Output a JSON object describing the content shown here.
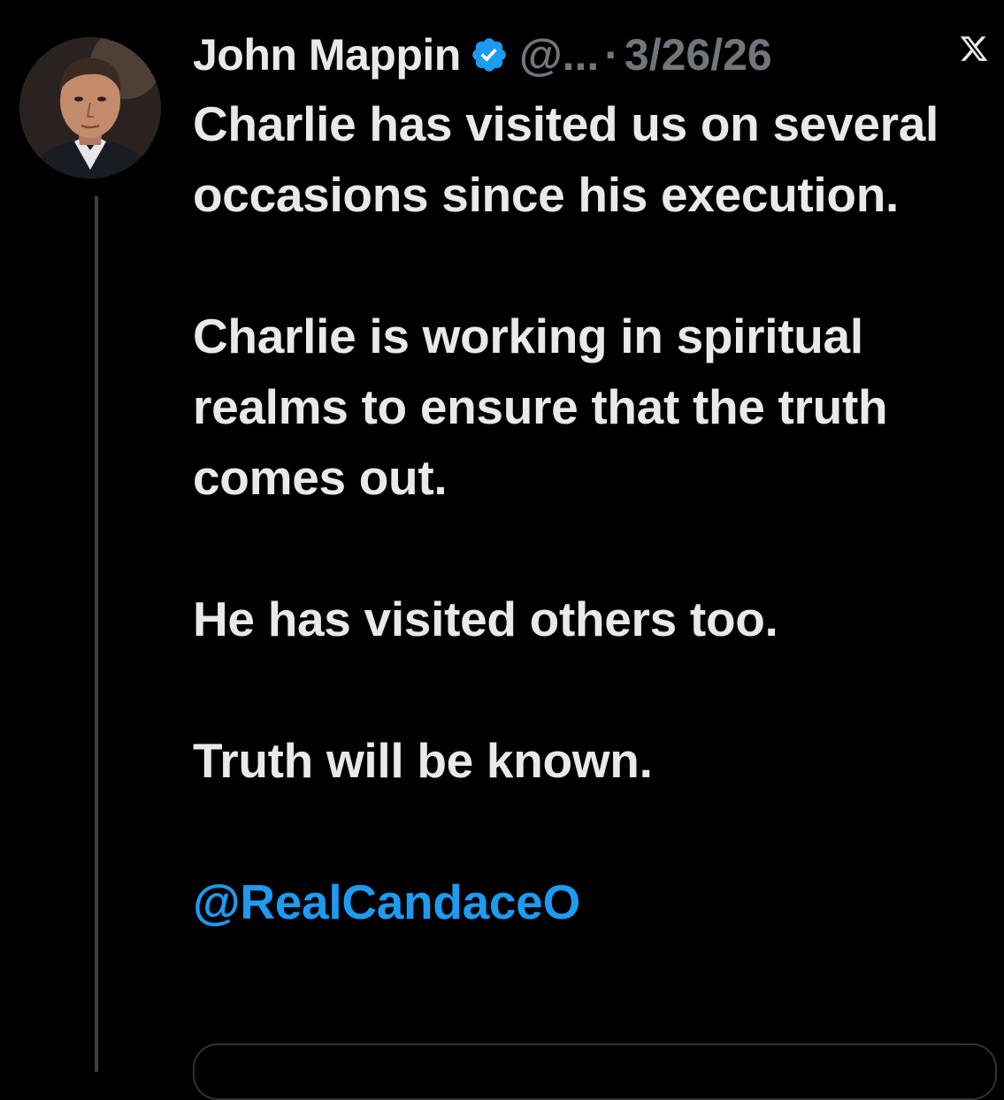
{
  "author": {
    "display_name": "John Mappin",
    "handle": "@...",
    "separator": "·",
    "date": "3/26/26",
    "verified": true,
    "avatar_icon": "profile-photo"
  },
  "platform_icon": "x-logo-icon",
  "post": {
    "paragraphs": [
      "Charlie has visited us on several occasions since his execution.",
      "Charlie is working in spiritual realms to ensure that the truth comes out.",
      "He has visited others too.",
      "Truth will be known."
    ],
    "mention": "@RealCandaceO"
  },
  "colors": {
    "background": "#000000",
    "text": "#e7e9ea",
    "secondary": "#71767b",
    "link": "#1d9bf0",
    "verified_badge": "#1d9bf0"
  }
}
